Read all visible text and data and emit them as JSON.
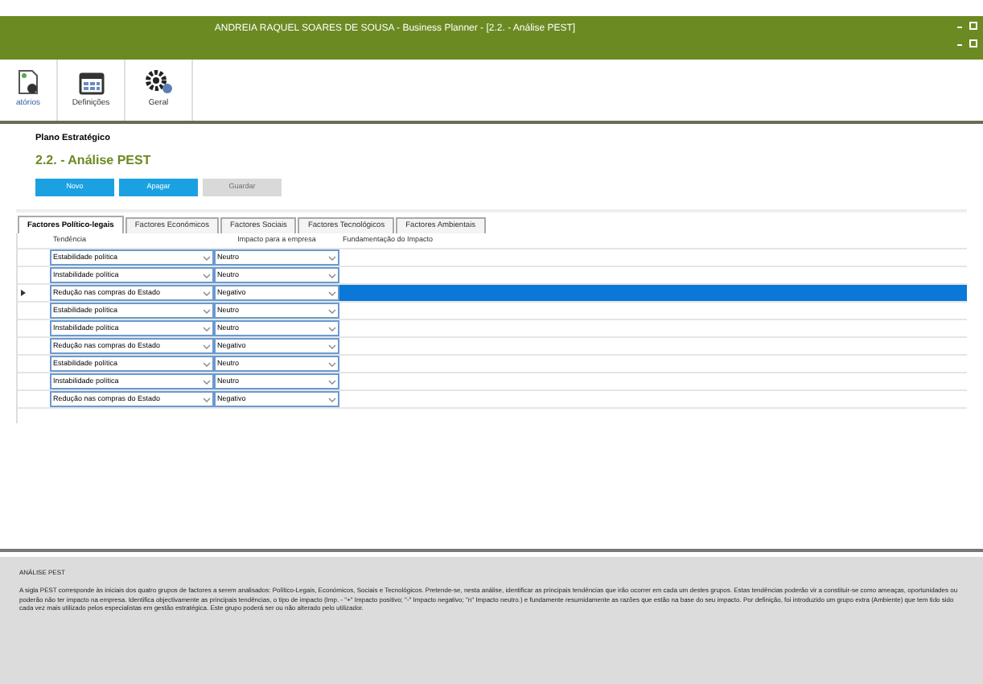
{
  "window": {
    "title": "ANDREIA RAQUEL SOARES DE SOUSA - Business Planner - [2.2. - Análise PEST]"
  },
  "toolbar": [
    {
      "label": "atórios",
      "kind": "report"
    },
    {
      "label": "Definições",
      "kind": "calendar"
    },
    {
      "label": "Geral",
      "kind": "gears"
    }
  ],
  "breadcrumb": "Plano Estratégico",
  "heading": "2.2. - Análise PEST",
  "buttons": [
    {
      "label": "Novo",
      "disabled": false
    },
    {
      "label": "Apagar",
      "disabled": false
    },
    {
      "label": "Guardar",
      "disabled": true
    }
  ],
  "tabs": [
    {
      "label": "Factores Político-legais",
      "selected": true
    },
    {
      "label": "Factores Económicos",
      "selected": false
    },
    {
      "label": "Factores Sociais",
      "selected": false
    },
    {
      "label": "Factores Tecnológicos",
      "selected": false
    },
    {
      "label": "Factores Ambientais",
      "selected": false
    }
  ],
  "table": {
    "columns": [
      "Tendência",
      "Impacto para a empresa",
      "Fundamentação do Impacto"
    ],
    "rows": [
      {
        "trend": "Estabilidade política",
        "impact": "Neutro",
        "selected": false
      },
      {
        "trend": "Instabilidade política",
        "impact": "Neutro",
        "selected": false
      },
      {
        "trend": "Redução nas compras do Estado",
        "impact": "Negativo",
        "selected": true
      },
      {
        "trend": "Estabilidade política",
        "impact": "Neutro",
        "selected": false
      },
      {
        "trend": "Instabilidade política",
        "impact": "Neutro",
        "selected": false
      },
      {
        "trend": "Redução nas compras do Estado",
        "impact": "Negativo",
        "selected": false
      },
      {
        "trend": "Estabilidade política",
        "impact": "Neutro",
        "selected": false
      },
      {
        "trend": "Instabilidade política",
        "impact": "Neutro",
        "selected": false
      },
      {
        "trend": "Redução nas compras do Estado",
        "impact": "Negativo",
        "selected": false
      }
    ]
  },
  "help": {
    "title": "ANÁLISE PEST",
    "text": "A sigla PEST corresponde às iniciais dos quatro grupos de factores a serem analisados: Político-Legais, Económicos, Sociais e Tecnológicos. Pretende-se, nesta análise, identificar as principais tendências que irão ocorrer em cada um destes grupos. Estas tendências poderão vir a constituir-se como ameaças, oportunidades ou poderão não ter impacto na empresa. Identifica objectivamente as principais tendências, o tipo de impacto (Imp. - \"+\" Impacto positivo; \"-\" Impacto negativo; \"n\" Impacto neutro.) e fundamente resumidamente as razões que estão na base do seu impacto. Por definição, foi introduzido um grupo extra (Ambiente) que tem tido sido cada vez mais utilizado pelos especialistas em gestão estratégica. Este grupo poderá ser ou não alterado pelo utilizador."
  }
}
